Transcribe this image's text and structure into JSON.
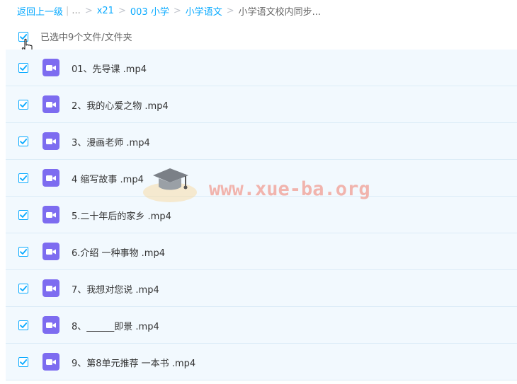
{
  "breadcrumb": {
    "back": "返回上一级",
    "pipe": "|",
    "ellipsis": "...",
    "sep": ">",
    "items": [
      "x21",
      "003 小学",
      "小学语文"
    ],
    "current": "小学语文校内同步..."
  },
  "selection": {
    "label": "已选中9个文件/文件夹"
  },
  "files": [
    {
      "name": "01、先导课 .mp4"
    },
    {
      "name": "2、我的心爱之物 .mp4"
    },
    {
      "name": "3、漫画老师 .mp4"
    },
    {
      "name": "4 缩写故事 .mp4"
    },
    {
      "name": "5.二十年后的家乡 .mp4"
    },
    {
      "name": "6.介绍 一种事物 .mp4"
    },
    {
      "name": "7、我想对您说 .mp4"
    },
    {
      "name": "8、______即景 .mp4"
    },
    {
      "name": "9、第8单元推荐 一本书 .mp4"
    }
  ],
  "watermark": {
    "text": "www.xue-ba.org"
  },
  "colors": {
    "accent": "#09AAFF",
    "video_icon": "#7d6cf0",
    "row_bg": "#f2f9fe"
  },
  "icons": {
    "file": "video-file-icon",
    "check": "check-icon"
  }
}
